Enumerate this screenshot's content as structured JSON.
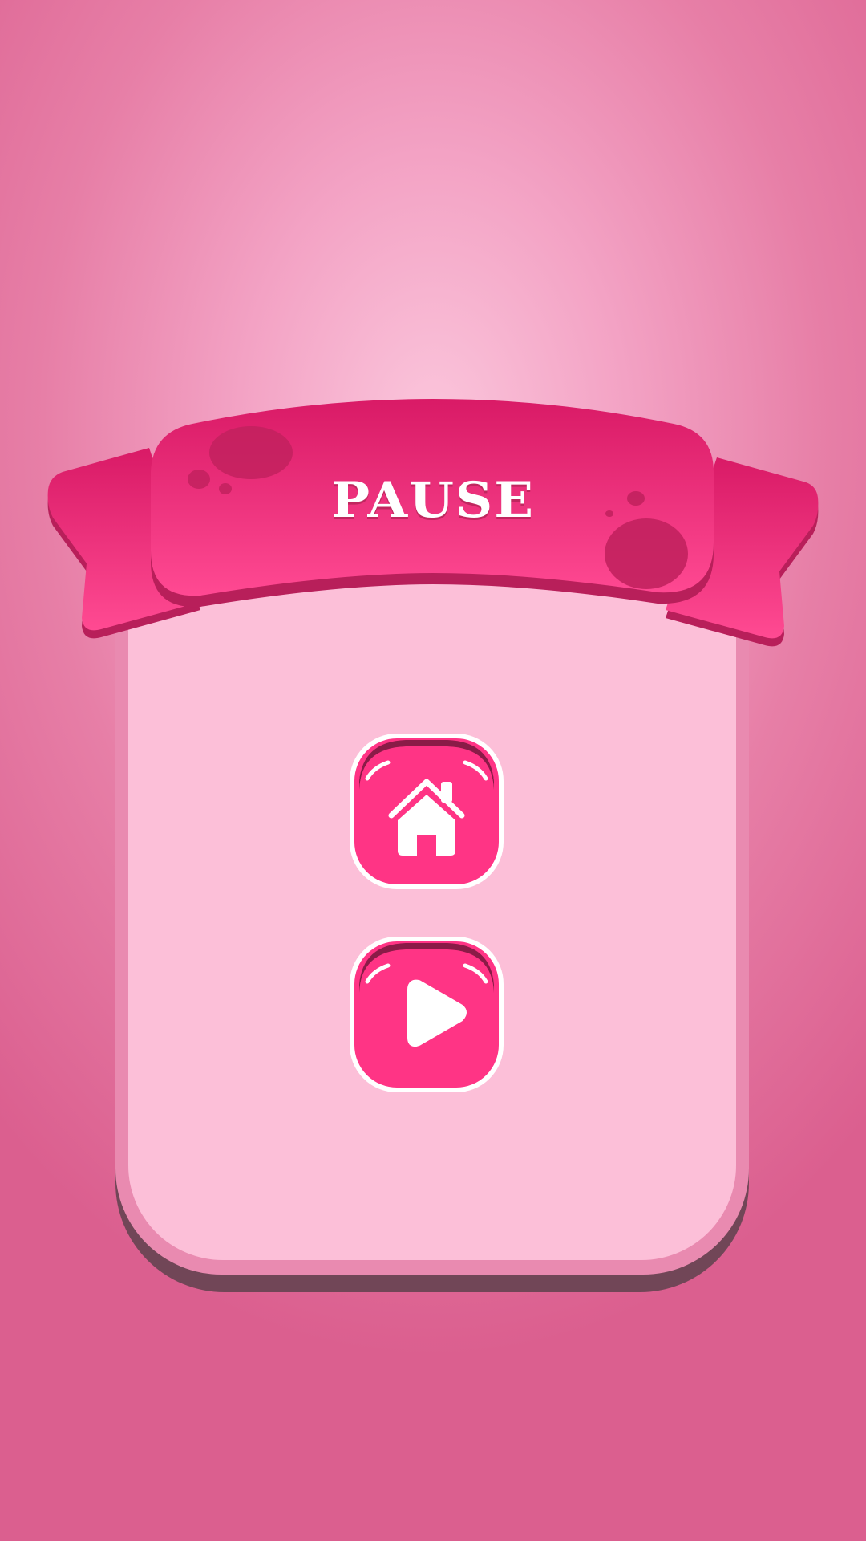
{
  "title": "PAUSE",
  "buttons": {
    "home": {
      "icon": "home-icon"
    },
    "resume": {
      "icon": "play-icon"
    }
  },
  "colors": {
    "banner": "#e0246e",
    "banner_dark": "#c21f5e",
    "button": "#ff3485",
    "button_border": "#ffffff",
    "panel": "#fcbfd8",
    "panel_rim": "#e98ab0"
  }
}
